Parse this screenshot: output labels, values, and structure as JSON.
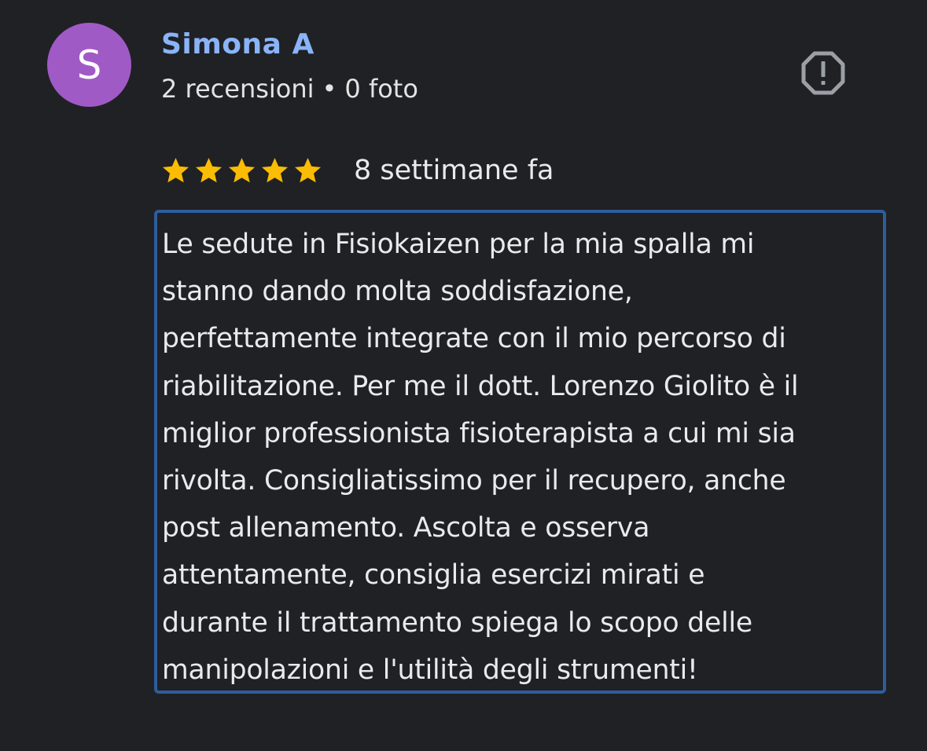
{
  "reviewer": {
    "avatar_letter": "S",
    "avatar_color": "#a05ac6",
    "name": "Simona A",
    "name_color": "#8ab4f8",
    "reviews_count": "2 recensioni",
    "separator": "•",
    "photos_count": "0 foto"
  },
  "report": {
    "icon": "report-octagon-icon",
    "color": "#9aa0a6"
  },
  "rating": {
    "stars": 5,
    "max_stars": 5,
    "star_color": "#fbbc04",
    "time_ago": "8 settimane fa"
  },
  "review": {
    "text": "Le sedute in Fisiokaizen per la mia spalla mi\nstanno dando molta soddisfazione,\nperfettamente integrate con il mio percorso di\nriabilitazione. Per me il dott. Lorenzo Giolito è il\nmiglior professionista fisioterapista a cui mi sia\nrivolta. Consigliatissimo per il recupero, anche\npost allenamento. Ascolta e osserva\nattentamente, consiglia esercizi mirati e\ndurante il trattamento spiega lo scopo delle\nmanipolazioni e l'utilità degli strumenti!",
    "highlight_color": "#2e5d9f"
  }
}
